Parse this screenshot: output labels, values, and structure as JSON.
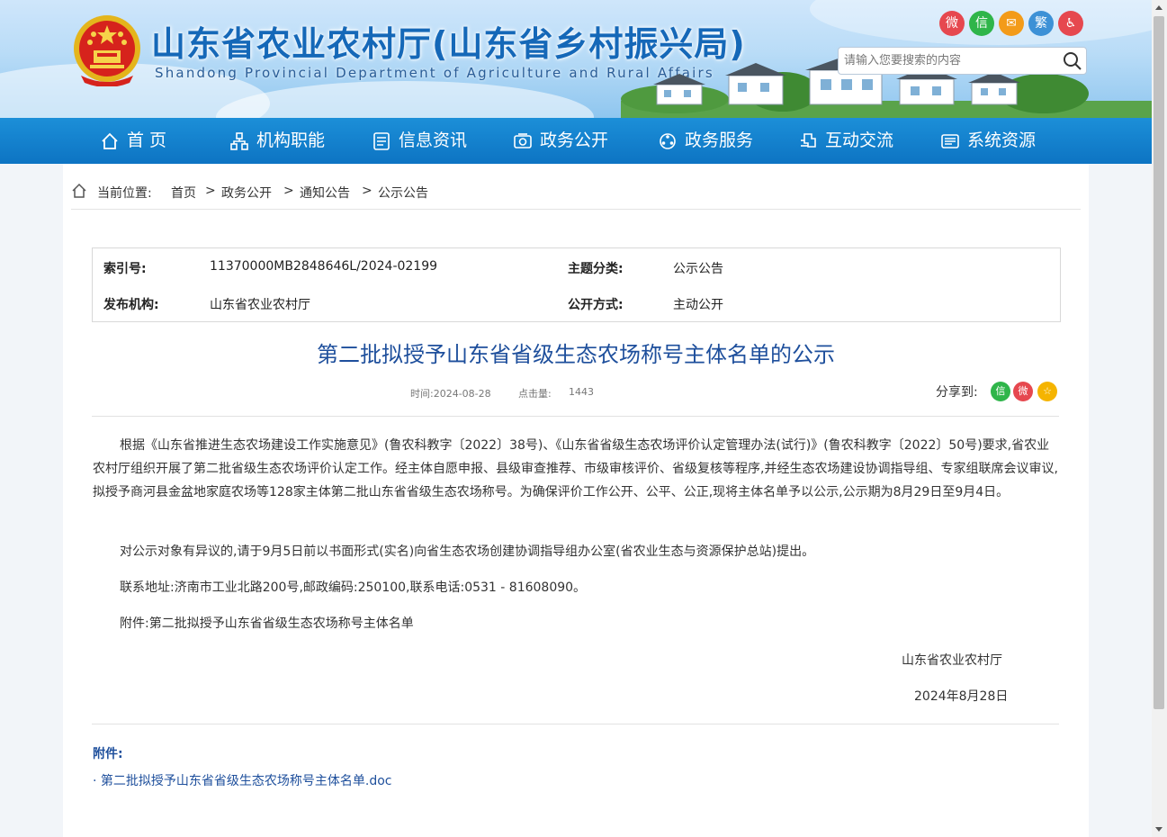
{
  "header": {
    "title": "山东省农业农村厅(山东省乡村振兴局)",
    "subtitle": "Shandong Provincial Department of Agriculture and Rural Affairs",
    "search_placeholder": "请输入您要搜索的内容",
    "social": [
      {
        "name": "weibo-icon",
        "glyph": "微",
        "color": "#e6484f"
      },
      {
        "name": "wechat-icon",
        "glyph": "信",
        "color": "#2fb54a"
      },
      {
        "name": "mail-icon",
        "glyph": "✉",
        "color": "#f39b19"
      },
      {
        "name": "traditional-chinese-icon",
        "glyph": "繁",
        "color": "#3d91d6"
      },
      {
        "name": "accessibility-icon",
        "glyph": "♿",
        "color": "#e6484f"
      }
    ]
  },
  "nav": {
    "items": [
      "首 页",
      "机构职能",
      "信息资讯",
      "政务公开",
      "政务服务",
      "互动交流",
      "系统资源"
    ]
  },
  "breadcrumb": {
    "label": "当前位置:",
    "items": [
      "首页",
      "政务公开",
      "通知公告",
      "公示公告"
    ],
    "separator": ">"
  },
  "meta": {
    "index_label": "索引号:",
    "index_value": "11370000MB2848646L/2024-02199",
    "category_label": "主题分类:",
    "category_value": "公示公告",
    "publisher_label": "发布机构:",
    "publisher_value": "山东省农业农村厅",
    "mode_label": "公开方式:",
    "mode_value": "主动公开"
  },
  "article": {
    "title": "第二批拟授予山东省省级生态农场称号主体名单的公示",
    "time": "时间:2024-08-28",
    "hits_label": "点击量:",
    "hits": "1443",
    "share_label": "分享到:",
    "share_icons": [
      {
        "name": "share-wechat-icon",
        "glyph": "信",
        "color": "#2fb54a"
      },
      {
        "name": "share-weibo-icon",
        "glyph": "微",
        "color": "#e6484f"
      },
      {
        "name": "share-favorite-icon",
        "glyph": "☆",
        "color": "#f5b400"
      }
    ],
    "paragraphs": [
      "根据《山东省推进生态农场建设工作实施意见》(鲁农科教字〔2022〕38号)、《山东省省级生态农场评价认定管理办法(试行)》(鲁农科教字〔2022〕50号)要求,省农业农村厅组织开展了第二批省级生态农场评价认定工作。经主体自愿申报、县级审查推荐、市级审核评价、省级复核等程序,并经生态农场建设协调指导组、专家组联席会议审议,拟授予商河县金盆地家庭农场等128家主体第二批山东省省级生态农场称号。为确保评价工作公开、公平、公正,现将主体名单予以公示,公示期为8月29日至9月4日。",
      "对公示对象有异议的,请于9月5日前以书面形式(实名)向省生态农场创建协调指导组办公室(省农业生态与资源保护总站)提出。",
      "联系地址:济南市工业北路200号,邮政编码:250100,联系电话:0531 - 81608090。",
      "附件:第二批拟授予山东省省级生态农场称号主体名单"
    ],
    "signature": "山东省农业农村厅",
    "date": "2024年8月28日",
    "attachment_label": "附件:",
    "attachment_link": "· 第二批拟授予山东省省级生态农场称号主体名单.doc"
  }
}
